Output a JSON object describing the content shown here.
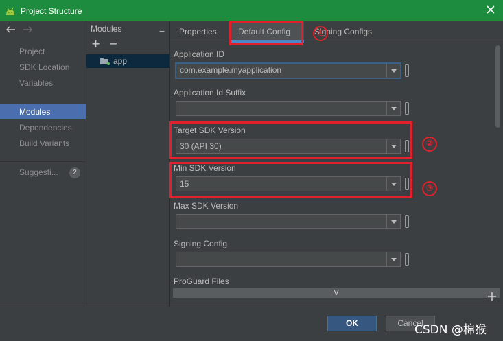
{
  "window": {
    "title": "Project Structure"
  },
  "left_nav": {
    "items": [
      {
        "label": "Project"
      },
      {
        "label": "SDK Location"
      },
      {
        "label": "Variables"
      },
      {
        "label": "Modules"
      },
      {
        "label": "Dependencies"
      },
      {
        "label": "Build Variants"
      },
      {
        "label": "Suggesti..."
      }
    ],
    "selected": "Modules",
    "suggestions_count": "2"
  },
  "modules": {
    "header": "Modules",
    "collapse": "−",
    "add": "+",
    "remove": "−",
    "items": [
      {
        "label": "app"
      }
    ]
  },
  "tabs": [
    {
      "label": "Properties"
    },
    {
      "label": "Default Config"
    },
    {
      "label": "Signing Configs"
    }
  ],
  "active_tab": "Default Config",
  "form": {
    "application_id": {
      "label": "Application ID",
      "value": "com.example.myapplication"
    },
    "application_id_suffix": {
      "label": "Application Id Suffix",
      "value": ""
    },
    "target_sdk": {
      "label": "Target SDK Version",
      "value": "30 (API 30)"
    },
    "min_sdk": {
      "label": "Min SDK Version",
      "value": "15"
    },
    "max_sdk": {
      "label": "Max SDK Version",
      "value": ""
    },
    "signing_config": {
      "label": "Signing Config",
      "value": ""
    },
    "proguard": {
      "label": "ProGuard Files",
      "expand": "V"
    }
  },
  "annotations": [
    "①",
    "②",
    "③"
  ],
  "footer": {
    "ok": "OK",
    "cancel": "Cancel",
    "watermark": "CSDN @棉猴"
  },
  "colors": {
    "title_bar": "#1e8c3e",
    "selection": "#4b6eaf",
    "highlight": "#e0202a"
  }
}
